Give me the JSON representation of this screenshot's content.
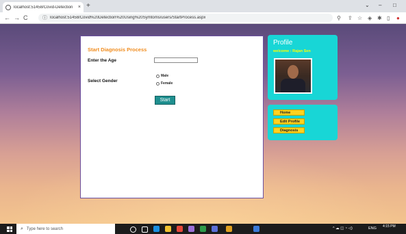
{
  "browser": {
    "tab_title": "localhost:51458/Covid-Detection",
    "tab_close": "×",
    "new_tab": "+",
    "url": "localhost:51458/Covid%20Detection%20Using%20Symtoms/users/StartProcess.aspx",
    "window_controls": {
      "menu": "⌄",
      "minimize": "–",
      "maximize": "□"
    }
  },
  "diagnosis": {
    "title": "Start Diagnosis Process",
    "age_label": "Enter the Age",
    "age_value": "",
    "gender_label": "Select Gender",
    "gender_options": [
      "Male",
      "Female"
    ],
    "start_label": "Start"
  },
  "profile": {
    "title": "Profile",
    "welcome": "welcome : Rajan Sen"
  },
  "menu": {
    "items": [
      "Home",
      "Edit Profile",
      "Diagnosis"
    ]
  },
  "taskbar": {
    "search_placeholder": "Type here to search",
    "lang": "ENG",
    "time": "4:15 PM"
  },
  "colors": {
    "accent_title": "#f08c1e",
    "panel": "#18d6d6",
    "menu_button": "#ffd21f",
    "start_button": "#1f8f8f"
  }
}
